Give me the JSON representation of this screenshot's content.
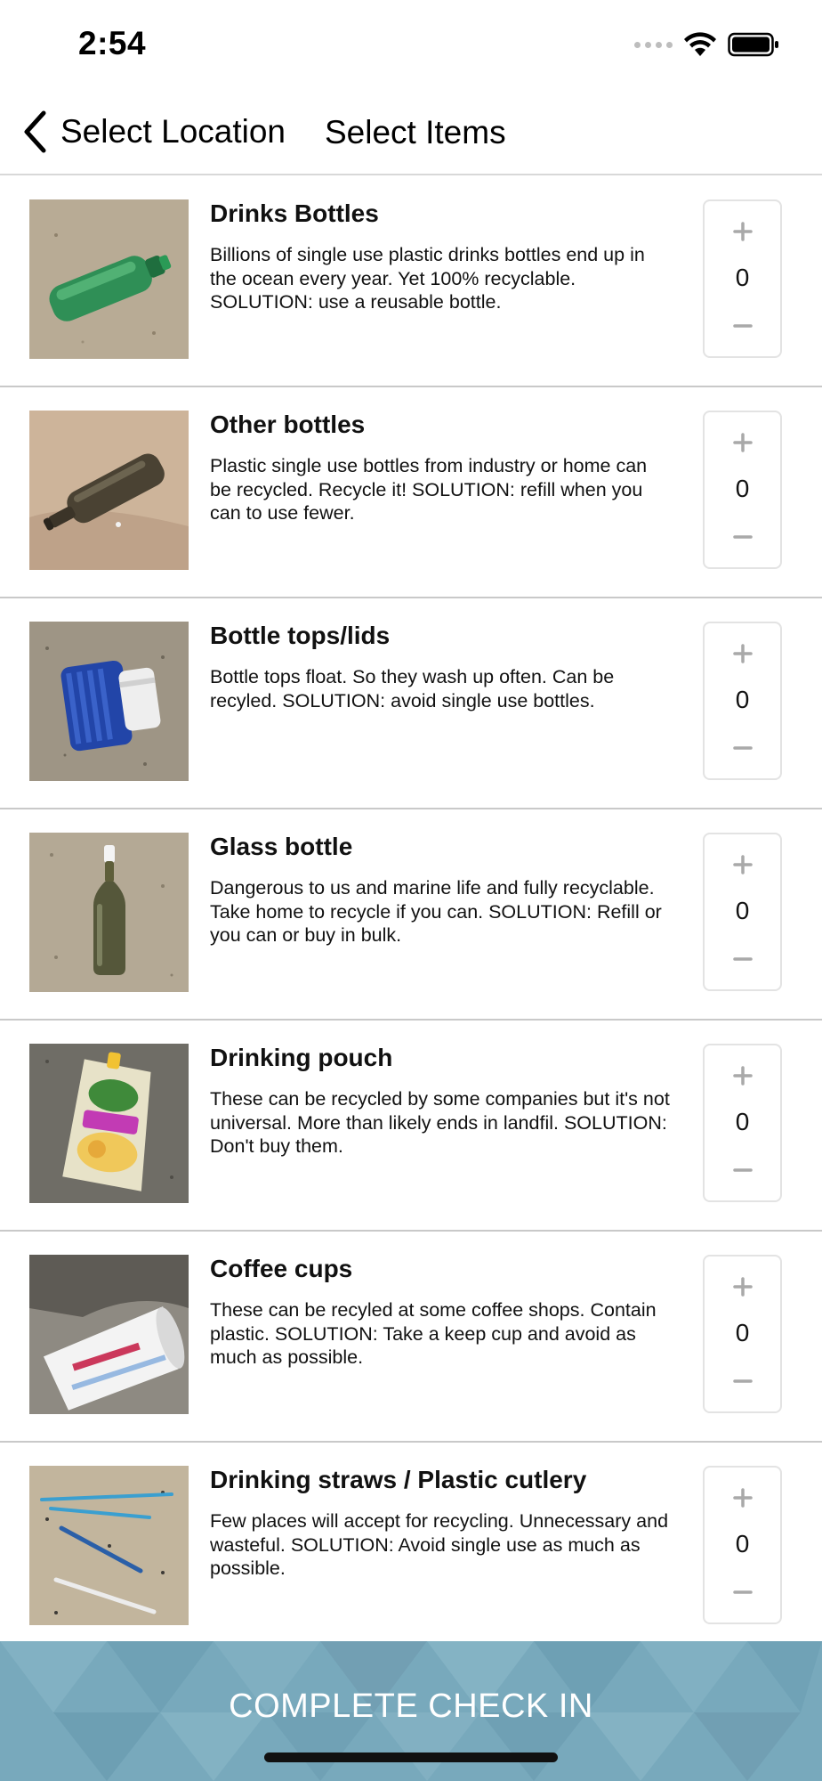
{
  "status_bar": {
    "time": "2:54"
  },
  "nav": {
    "back_label": "Select Location",
    "title": "Select Items"
  },
  "items": [
    {
      "title": "Drinks Bottles",
      "description": "Billions of single use plastic drinks bottles end up in the ocean every year. Yet 100% recyclable. SOLUTION: use a reusable bottle.",
      "count": "0",
      "image": "green-plastic-bottle-on-sand"
    },
    {
      "title": "Other bottles",
      "description": "Plastic single use bottles from industry or home can be recycled. Recycle it! SOLUTION: refill when you can to use fewer.",
      "count": "0",
      "image": "dark-bottle-on-sand"
    },
    {
      "title": "Bottle tops/lids",
      "description": "Bottle tops float. So they wash up often. Can be recyled. SOLUTION: avoid single use bottles.",
      "count": "0",
      "image": "blue-bottle-cap-on-sand"
    },
    {
      "title": "Glass bottle",
      "description": "Dangerous to us and marine life and fully recyclable. Take home to recycle if you can. SOLUTION: Refill or you can or buy in bulk.",
      "count": "0",
      "image": "glass-bottle-on-sand"
    },
    {
      "title": "Drinking pouch",
      "description": "These can be recycled by some companies but it's not universal. More than likely ends in landfil. SOLUTION: Don't buy them.",
      "count": "0",
      "image": "drink-pouch-on-sand"
    },
    {
      "title": "Coffee cups",
      "description": "These can be recyled at some coffee shops. Contain plastic. SOLUTION: Take a keep cup and avoid as much as possible.",
      "count": "0",
      "image": "coffee-cup-on-sand"
    },
    {
      "title": "Drinking straws / Plastic cutlery",
      "description": "Few places will accept for recycling. Unnecessary and wasteful. SOLUTION: Avoid single use as much as possible.",
      "count": "0",
      "image": "straws-on-sand"
    }
  ],
  "complete_button": {
    "label": "COMPLETE CHECK IN"
  },
  "colors": {
    "accent": "#78a9bc",
    "divider": "#c9c9c9",
    "stepper_border": "#e3e3e3",
    "stepper_icon": "#a9a9a9"
  }
}
